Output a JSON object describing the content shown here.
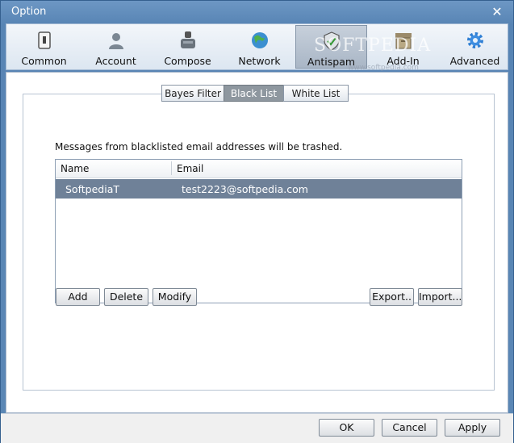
{
  "window": {
    "title": "Option"
  },
  "toolbar": {
    "items": [
      {
        "label": "Common",
        "icon": "common-icon"
      },
      {
        "label": "Account",
        "icon": "account-icon"
      },
      {
        "label": "Compose",
        "icon": "compose-icon"
      },
      {
        "label": "Network",
        "icon": "network-icon"
      },
      {
        "label": "Antispam",
        "icon": "antispam-shield-icon",
        "active": true
      },
      {
        "label": "Add-In",
        "icon": "addin-box-icon"
      },
      {
        "label": "Advanced",
        "icon": "gear-icon"
      }
    ]
  },
  "subtabs": [
    {
      "label": "Bayes Filter"
    },
    {
      "label": "Black List",
      "active": true
    },
    {
      "label": "White List"
    }
  ],
  "blacklist": {
    "description": "Messages from blacklisted email addresses will be trashed.",
    "columns": [
      "Name",
      "Email"
    ],
    "rows": [
      {
        "name": "SoftpediaT",
        "email": "test2223@softpedia.com",
        "selected": true
      }
    ],
    "buttons": {
      "add": "Add",
      "delete": "Delete",
      "modify": "Modify",
      "export": "Export..",
      "import": "Import..."
    }
  },
  "footer": {
    "ok": "OK",
    "cancel": "Cancel",
    "apply": "Apply"
  },
  "watermark": {
    "text": "SOFTPEDIA",
    "sub": "www.softpedia.com"
  },
  "colors": {
    "accent": "#5b87b5",
    "selection": "#6f8198"
  }
}
